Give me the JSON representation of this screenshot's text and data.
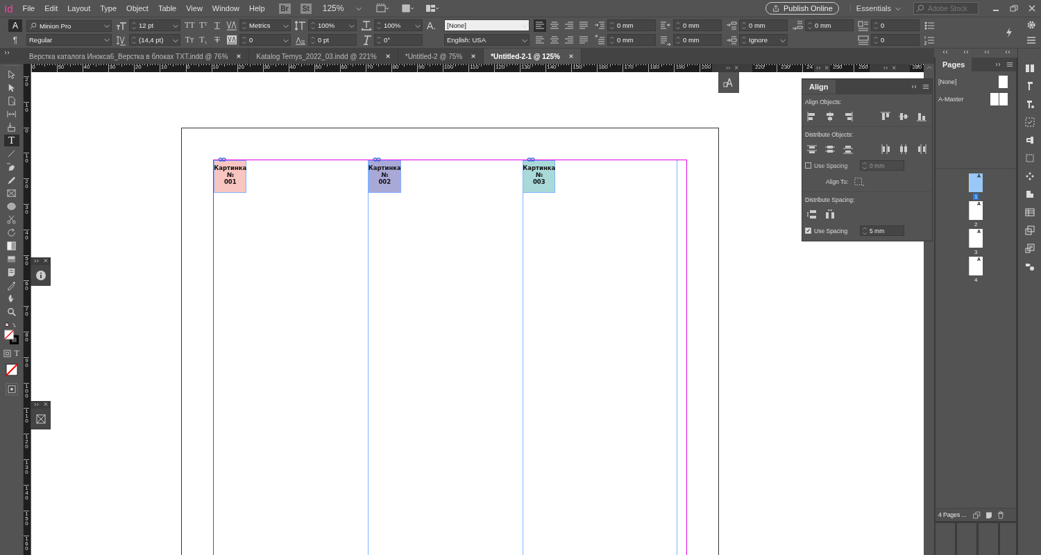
{
  "app_bar": {
    "logo": "Id",
    "menu": [
      "File",
      "Edit",
      "Layout",
      "Type",
      "Object",
      "Table",
      "View",
      "Window",
      "Help"
    ],
    "bridge": "Br",
    "stock": "St",
    "zoom": "125%",
    "publish": "Publish Online",
    "workspace": "Essentials",
    "search_placeholder": "Adobe Stock"
  },
  "control": {
    "modes": [
      {
        "glyph": "A",
        "selected": true
      },
      {
        "glyph": "¶",
        "selected": false
      }
    ],
    "font": "Minion Pro",
    "style": "Regular",
    "size": "12 pt",
    "leading": "(14,4 pt)",
    "case_buttons": [
      {
        "glyph": "TT",
        "kind": "plain"
      },
      {
        "glyph": "Tᵀ",
        "kind": "plain"
      },
      {
        "glyph": "T",
        "kind": "underline"
      },
      {
        "glyph": "Tт",
        "kind": "plain"
      },
      {
        "glyph": "T₁",
        "kind": "plain"
      },
      {
        "glyph": "T",
        "kind": "strike"
      }
    ],
    "kerning": "Metrics",
    "tracking": "0",
    "vertical_scale": "100%",
    "baseline_shift": "0 pt",
    "horizontal_scale": "100%",
    "skew": "0°",
    "char_style_glyph": "A.",
    "char_style": "[None]",
    "language": "English: USA",
    "alignments": [
      {
        "selected": true
      },
      {
        "selected": false
      },
      {
        "selected": false
      },
      {
        "selected": false
      },
      {
        "selected": false
      },
      {
        "selected": false
      },
      {
        "selected": false
      },
      {
        "selected": false
      }
    ],
    "left_indent": "0 mm",
    "first_line_indent": "0 mm",
    "right_indent": "0 mm",
    "last_line_indent": "0 mm",
    "space_before": "0 mm",
    "align_to_grid": "Ignore",
    "space_after": "0 mm",
    "drop_cap_lines": "0",
    "drop_cap_chars": "0"
  },
  "tabs": [
    {
      "label": "Верстка каталога Инокса6_Верстка в блоках TXT.indd @ 76%",
      "selected": false
    },
    {
      "label": "Katalog Ternys_2022_03.indd @ 221%",
      "selected": false
    },
    {
      "label": "*Untitled-2 @ 75%",
      "selected": false
    },
    {
      "label": "*Untitled-2-1 @ 125%",
      "selected": true
    }
  ],
  "tools": [
    {
      "kind": "selection",
      "selected": false
    },
    {
      "kind": "direct",
      "selected": false
    },
    {
      "kind": "page",
      "selected": false
    },
    {
      "kind": "gap",
      "selected": false
    },
    {
      "kind": "collector",
      "selected": false
    },
    {
      "kind": "type",
      "glyph": "T",
      "selected": true
    },
    {
      "kind": "line",
      "selected": false
    },
    {
      "kind": "pen",
      "selected": false
    },
    {
      "kind": "pencil",
      "selected": false
    },
    {
      "kind": "frame",
      "selected": false
    },
    {
      "kind": "ellipse",
      "selected": false
    },
    {
      "kind": "scissors",
      "selected": false
    },
    {
      "kind": "rotate",
      "selected": false
    },
    {
      "kind": "gradient",
      "selected": false
    },
    {
      "kind": "feather",
      "selected": false
    },
    {
      "kind": "note",
      "selected": false
    },
    {
      "kind": "eyedropper",
      "selected": false
    },
    {
      "kind": "hand",
      "selected": false
    },
    {
      "kind": "zoom",
      "selected": false
    }
  ],
  "formatting_text_glyph": "T",
  "horizontal_ruler": [
    [
      "0",
      "50",
      "40",
      "30",
      "20",
      "10",
      "0",
      "10",
      "20",
      "30",
      "40",
      "50",
      "60",
      "70",
      "80",
      "90",
      "100",
      "110",
      "120",
      "130",
      "140",
      "150",
      "160",
      "170",
      "180",
      "190",
      "200"
    ],
    [
      "220",
      "230",
      "24"
    ],
    [
      "250",
      "260"
    ],
    [
      "280"
    ]
  ],
  "vertical_ruler": [
    "20",
    "10",
    "0",
    "10",
    "20",
    "30",
    "40",
    "50",
    "60",
    "70",
    "80",
    "90",
    "100",
    "110",
    "120",
    "130",
    "140",
    "150",
    "160"
  ],
  "frames": [
    {
      "lines": [
        "Картинка",
        "№",
        "001"
      ],
      "color": "#f9c5c1"
    },
    {
      "lines": [
        "Картинка",
        "№",
        "002"
      ],
      "color": "#a9a9d7"
    },
    {
      "lines": [
        "Картинка",
        "№",
        "003"
      ],
      "color": "#a9d9d9"
    }
  ],
  "align_panel": {
    "title": "Align",
    "align_objects": "Align Objects:",
    "distribute_objects": "Distribute Objects:",
    "use_spacing_1": {
      "label": "Use Spacing",
      "checked": false,
      "value": "0 mm"
    },
    "align_to": "Align To:",
    "distribute_spacing": "Distribute Spacing:",
    "use_spacing_2": {
      "label": "Use Spacing",
      "checked": true,
      "value": "5 mm"
    }
  },
  "pages_panel": {
    "title": "Pages",
    "masters": [
      "[None]",
      "A-Master"
    ],
    "pages": [
      {
        "number": "1",
        "master": "A",
        "selected": true
      },
      {
        "number": "2",
        "master": "A",
        "selected": false
      },
      {
        "number": "3",
        "master": "A",
        "selected": false
      },
      {
        "number": "4",
        "master": "A",
        "selected": false
      }
    ],
    "footer": "4 Pages ..."
  }
}
